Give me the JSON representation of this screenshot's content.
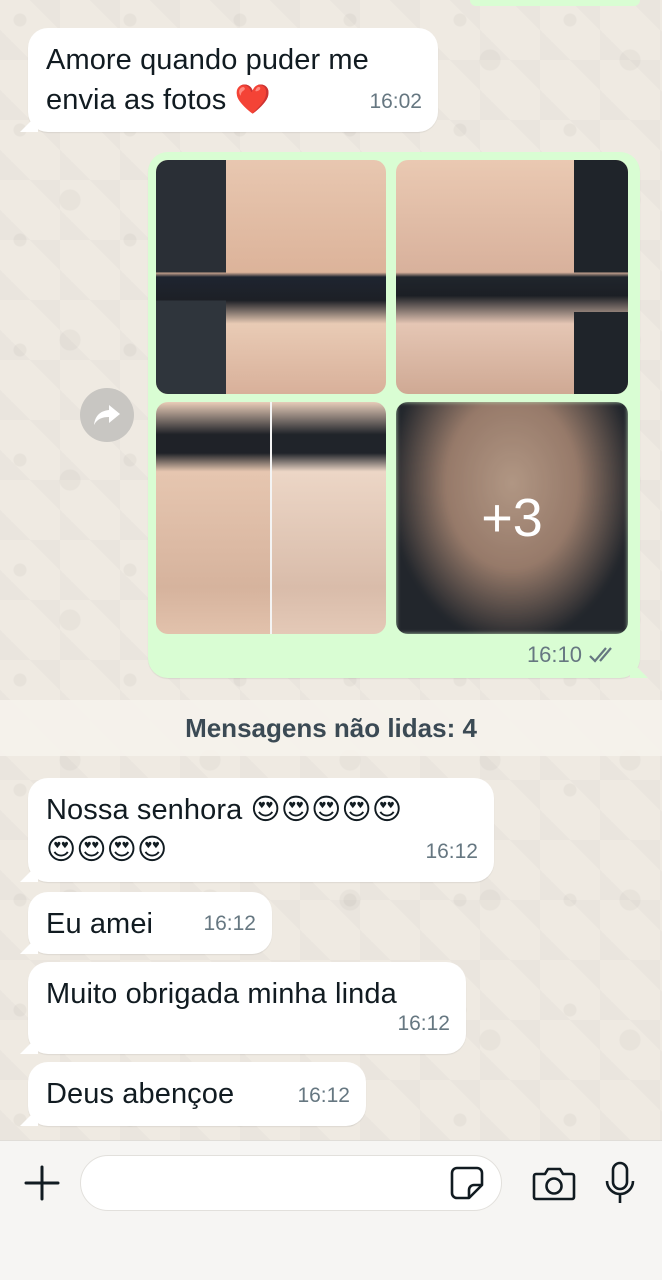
{
  "messages_before": [
    {
      "text_line1": "Amore quando puder me",
      "text_line2": "envia as fotos",
      "emoji": "❤️",
      "time": "16:02"
    }
  ],
  "media": {
    "more_count": "+3",
    "time": "16:10",
    "status": "double-check-icon"
  },
  "unread_banner": "Mensagens não lidas: 4",
  "messages_after": [
    {
      "text": "Nossa senhora 😍😍😍😍😍",
      "text_line2": "😍😍😍😍",
      "time": "16:12"
    },
    {
      "text": "Eu amei",
      "time": "16:12"
    },
    {
      "text": "Muito obrigada minha linda",
      "time": "16:12"
    },
    {
      "text": "Deus abençoe",
      "time": "16:12"
    }
  ],
  "composer": {
    "placeholder": "",
    "icons": [
      "plus-icon",
      "sticker-icon",
      "camera-icon",
      "microphone-icon"
    ]
  },
  "colors": {
    "outgoing_bubble": "#d9fdd3",
    "incoming_bubble": "#ffffff",
    "wallpaper": "#efeae2",
    "timestamp": "#667781",
    "read_ticks": "#667781"
  }
}
